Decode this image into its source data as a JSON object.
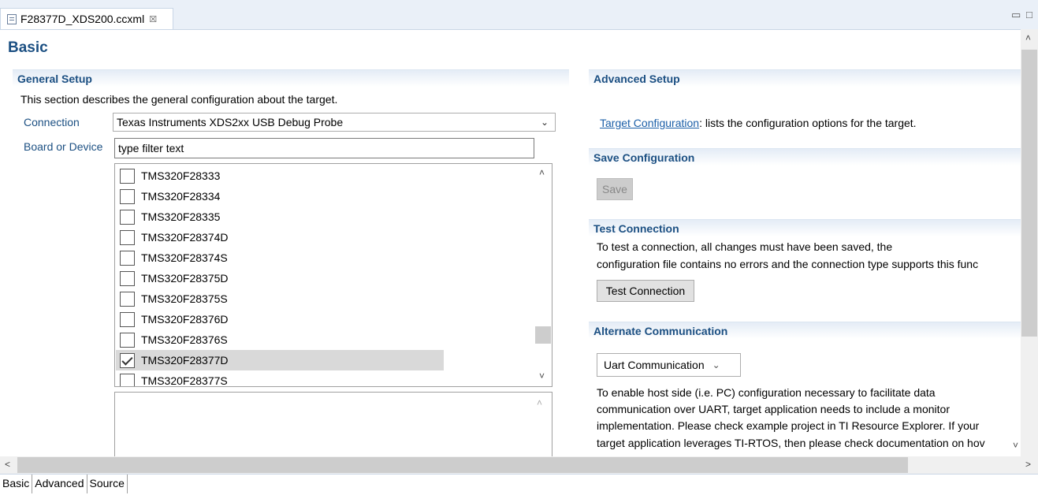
{
  "editor": {
    "tab_title": "F28377D_XDS200.ccxml",
    "tab_close": "☒",
    "minimize": "▭",
    "maximize": "□"
  },
  "page": {
    "title": "Basic"
  },
  "general": {
    "heading": "General Setup",
    "description": "This section describes the general configuration about the target.",
    "connection_label": "Connection",
    "connection_value": "Texas Instruments XDS2xx USB Debug Probe",
    "board_label": "Board or Device",
    "filter_placeholder": "type filter text",
    "devices": [
      {
        "name": "TMS320F28333",
        "checked": false
      },
      {
        "name": "TMS320F28334",
        "checked": false
      },
      {
        "name": "TMS320F28335",
        "checked": false
      },
      {
        "name": "TMS320F28374D",
        "checked": false
      },
      {
        "name": "TMS320F28374S",
        "checked": false
      },
      {
        "name": "TMS320F28375D",
        "checked": false
      },
      {
        "name": "TMS320F28375S",
        "checked": false
      },
      {
        "name": "TMS320F28376D",
        "checked": false
      },
      {
        "name": "TMS320F28376S",
        "checked": false
      },
      {
        "name": "TMS320F28377D",
        "checked": true
      },
      {
        "name": "TMS320F28377S",
        "checked": false
      }
    ]
  },
  "advanced": {
    "heading": "Advanced Setup",
    "link_text": "Target Configuration",
    "link_suffix": ": lists the configuration options for the target."
  },
  "save": {
    "heading": "Save Configuration",
    "button": "Save"
  },
  "test": {
    "heading": "Test Connection",
    "line1": "To test a connection, all changes must have been saved, the",
    "line2": "configuration file contains no errors and the connection type supports this func",
    "button": "Test Connection"
  },
  "alternate": {
    "heading": "Alternate Communication",
    "select_value": "Uart Communication",
    "lines": [
      "To enable host side (i.e. PC) configuration necessary to facilitate data",
      "communication over UART, target application needs to include a monitor",
      "implementation. Please check example project in TI Resource Explorer. If your",
      "target application leverages TI-RTOS, then please check documentation on hov"
    ]
  },
  "bottom_tabs": [
    "Basic",
    "Advanced",
    "Source"
  ]
}
